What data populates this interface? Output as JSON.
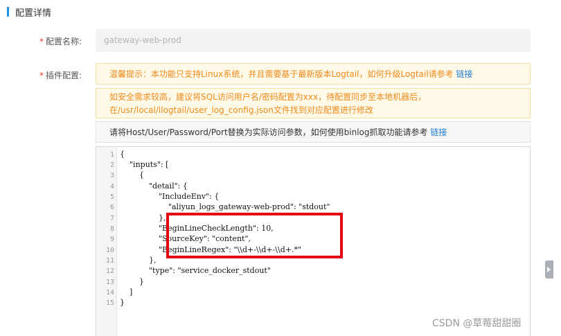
{
  "section": {
    "title": "配置详情"
  },
  "form": {
    "required_mark": "*",
    "name_label": "配置名称:",
    "name_value": "gateway-web-prod",
    "plugin_label": "插件配置:"
  },
  "notices": {
    "n1_text": "温馨提示：本功能只支持Linux系统，并且需要基于最新版本Logtail，如何升级Logtail请参考",
    "n1_link": "链接",
    "n2_line1": "如安全需求较高，建议将SQL访问用户名/密码配置为xxx，待配置同步至本地机器后，",
    "n2_line2": "在/usr/local/ilogtail/user_log_config.json文件找到对应配置进行修改",
    "n3_text": "请将Host/User/Password/Port替换为实际访问参数，如何使用binlog抓取功能请参考",
    "n3_link": "链接"
  },
  "editor": {
    "line_numbers": [
      "1",
      "2",
      "3",
      "4",
      "5",
      "6",
      "7",
      "8",
      "9",
      "10",
      "11",
      "12",
      "13",
      "14",
      "15"
    ],
    "lines": [
      "{",
      "    \"inputs\": [",
      "        {",
      "            \"detail\": {",
      "                \"IncludeEnv\": {",
      "                    \"aliyun_logs_gateway-web-prod\": \"stdout\"",
      "                },",
      "                \"BeginLineCheckLength\": 10,",
      "                \"SourceKey\": \"content\",",
      "                \"BeginLineRegex\": \"\\\\d+-\\\\d+-\\\\d+.*\"",
      "            },",
      "            \"type\": \"service_docker_stdout\"",
      "        }",
      "    ]",
      "}"
    ]
  },
  "watermark": "CSDN @草莓甜甜圈",
  "colors": {
    "accent": "#1f8fe6",
    "warning_text": "#f08a1b",
    "highlight": "#e3000f",
    "link": "#1a7bd6"
  }
}
